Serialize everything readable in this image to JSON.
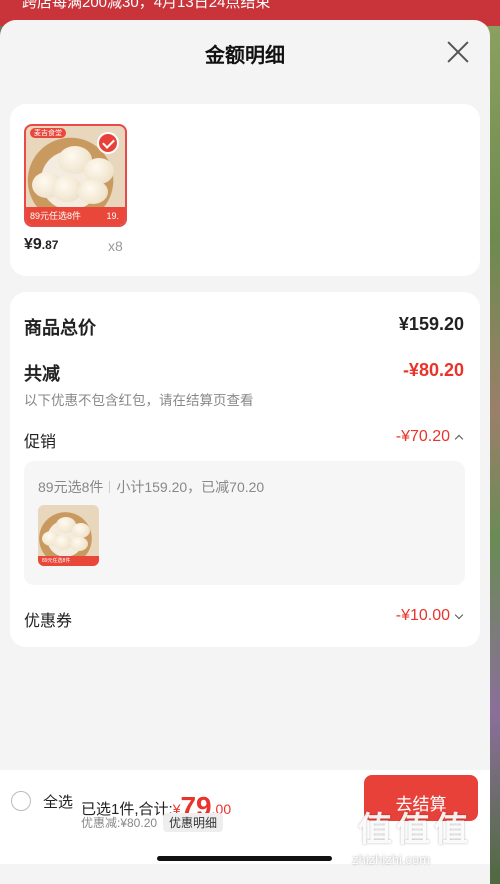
{
  "banner": {
    "text": "跨店每满200减30，4月13日24点结束"
  },
  "sheet": {
    "title": "金额明细"
  },
  "product": {
    "thumb_top": "麦吉食堂",
    "thumb_caption": "89元任选8件",
    "thumb_price": "19.",
    "price_int": "¥9",
    "price_dec": ".87",
    "qty": "x8"
  },
  "pricing": {
    "total_label": "商品总价",
    "total_value": "¥159.20",
    "reduce_label": "共减",
    "reduce_value": "-¥80.20",
    "note": "以下优惠不包含红包，请在结算页查看",
    "promo_label": "促销",
    "promo_value": "-¥70.20",
    "promo_desc_a": "89元选8件",
    "promo_desc_b": "小计159.20，已减70.20",
    "promo_thumb_caption": "89元任选8件",
    "coupon_label": "优惠券",
    "coupon_value": "-¥10.00"
  },
  "bottom": {
    "select_all": "全选",
    "selected_prefix": "已选1件,合计:",
    "total_currency": "¥",
    "total_int": "79",
    "total_dec": ".00",
    "discount_text": "优惠减:¥80.20",
    "detail_chip": "优惠明细",
    "checkout": "去结算"
  },
  "watermark": {
    "glyphs": "值值值",
    "url": "zhizhizhi.com"
  },
  "colors": {
    "accent_red": "#e8342b",
    "button_red": "#e8413a"
  }
}
